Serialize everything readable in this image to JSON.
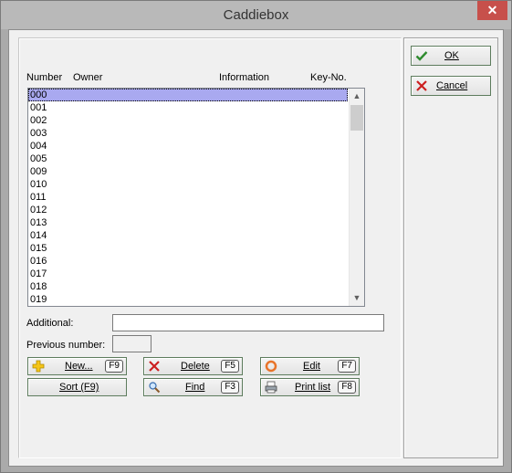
{
  "window": {
    "title": "Caddiebox",
    "close_glyph": "✕"
  },
  "list": {
    "headers": {
      "number": "Number",
      "owner": "Owner",
      "information": "Information",
      "key_no": "Key-No."
    },
    "rows": [
      "000",
      "001",
      "002",
      "003",
      "004",
      "005",
      "009",
      "010",
      "011",
      "012",
      "013",
      "014",
      "015",
      "016",
      "017",
      "018",
      "019"
    ],
    "selected_index": 0
  },
  "fields": {
    "additional_label": "Additional:",
    "additional_value": "",
    "previous_number_label": "Previous number:",
    "previous_number_value": ""
  },
  "buttons": {
    "new": {
      "label": "New...",
      "key": "F9",
      "icon": "plus-icon"
    },
    "delete": {
      "label": "Delete",
      "key": "F5",
      "icon": "delete-x-icon"
    },
    "edit": {
      "label": "Edit",
      "key": "F7",
      "icon": "edit-ring-icon"
    },
    "sort": {
      "label": "Sort (F9)"
    },
    "find": {
      "label": "Find",
      "key": "F3",
      "icon": "magnifier-icon"
    },
    "print_list": {
      "label": "Print list",
      "key": "F8",
      "icon": "printer-icon"
    },
    "ok": {
      "label": "OK",
      "icon": "checkmark-icon"
    },
    "cancel": {
      "label": "Cancel",
      "icon": "cancel-x-icon"
    }
  },
  "colors": {
    "selection": "#a9a9f0",
    "button_border": "#5d7c5d",
    "close_button": "#c7504b"
  }
}
